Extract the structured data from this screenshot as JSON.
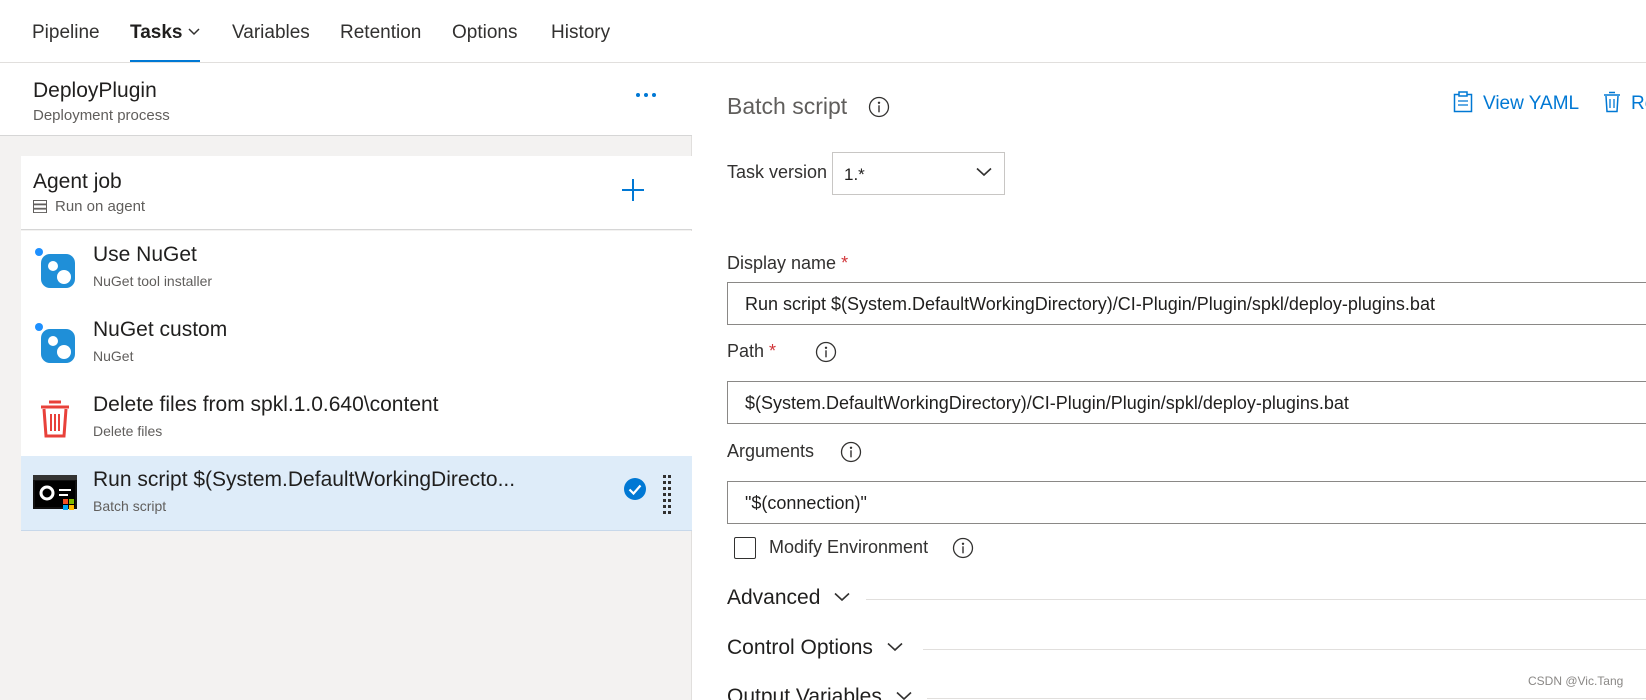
{
  "tabs": [
    {
      "label": "Pipeline"
    },
    {
      "label": "Tasks",
      "active": true
    },
    {
      "label": "Variables"
    },
    {
      "label": "Retention"
    },
    {
      "label": "Options"
    },
    {
      "label": "History"
    }
  ],
  "process": {
    "title": "DeployPlugin",
    "subtitle": "Deployment process"
  },
  "agent_job": {
    "title": "Agent job",
    "subtitle": "Run on agent"
  },
  "task_list": [
    {
      "name": "Use NuGet",
      "type": "NuGet tool installer",
      "icon": "nuget-icon"
    },
    {
      "name": "NuGet custom",
      "type": "NuGet",
      "icon": "nuget-icon"
    },
    {
      "name": "Delete files from spkl.1.0.640\\content",
      "type": "Delete files",
      "icon": "trash-icon"
    },
    {
      "name": "Run script $(System.DefaultWorkingDirecto...",
      "type": "Batch script",
      "icon": "batch-script-icon",
      "selected": true
    }
  ],
  "details": {
    "title": "Batch script",
    "view_yaml": "View YAML",
    "remove": "Re",
    "task_version_label": "Task version",
    "task_version_value": "1.*",
    "display_name_label": "Display name",
    "display_name_value": "Run script $(System.DefaultWorkingDirectory)/CI-Plugin/Plugin/spkl/deploy-plugins.bat",
    "path_label": "Path",
    "path_value": "$(System.DefaultWorkingDirectory)/CI-Plugin/Plugin/spkl/deploy-plugins.bat",
    "arguments_label": "Arguments",
    "arguments_value": "\"$(connection)\"",
    "modify_env_label": "Modify Environment",
    "required_mark": "*",
    "sections": [
      {
        "label": "Advanced"
      },
      {
        "label": "Control Options"
      },
      {
        "label": "Output Variables"
      }
    ]
  },
  "watermark": "CSDN @Vic.Tang",
  "colors": {
    "accent": "#0078d4",
    "required": "#d13438",
    "selected_row": "#deecf9",
    "panel_bg": "#f3f2f1"
  }
}
